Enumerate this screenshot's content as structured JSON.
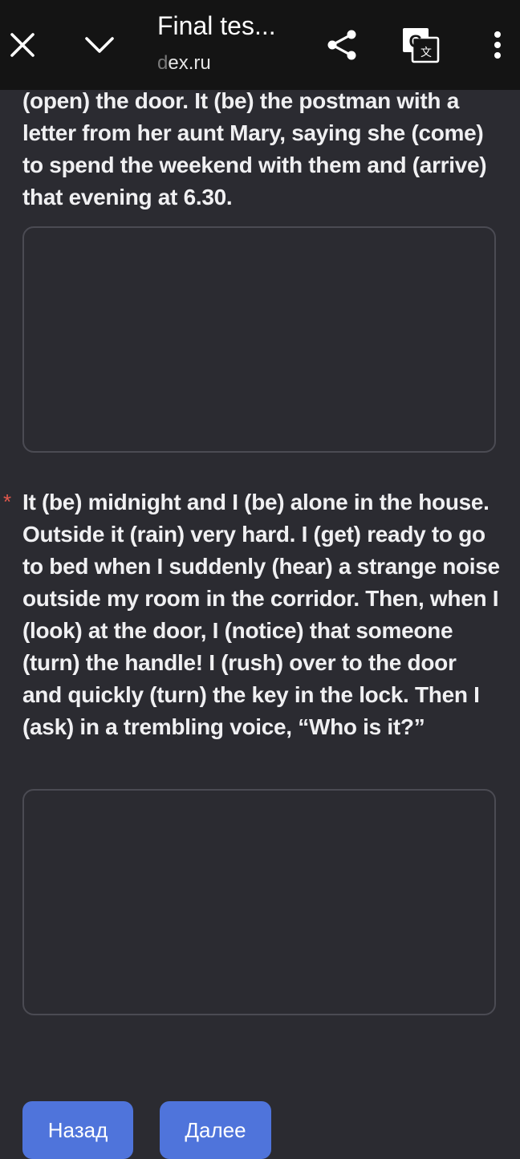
{
  "browser": {
    "tab_title": "Final tes...",
    "url_faded": "d",
    "url_rest": "ex.ru",
    "icons": [
      "close-icon",
      "chevron-down-icon",
      "share-icon",
      "translate-icon",
      "more-vert-icon"
    ]
  },
  "form": {
    "questions": [
      {
        "text": "(open) the door. It (be) the postman with a letter from her aunt Mary, saying she (come) to spend the weekend with them and (arrive) that evening at 6.30.",
        "answer": ""
      },
      {
        "required_mark": "*",
        "text": "It (be) midnight and I (be) alone in the house. Outside it (rain) very hard. I (get) ready to go to bed when I suddenly (hear) a strange noise outside my room in the corridor. Then, when I (look) at the door, I (notice) that someone (turn) the handle! I (rush) over to the door and quickly (turn) the key in the lock. Then I (ask) in a trembling voice, “Who is it?”",
        "answer": ""
      }
    ],
    "back_label": "Назад",
    "next_label": "Далее"
  },
  "colors": {
    "background": "#2b2b31",
    "topbar": "#141414",
    "button": "#4f74db",
    "required": "#e2584c"
  }
}
